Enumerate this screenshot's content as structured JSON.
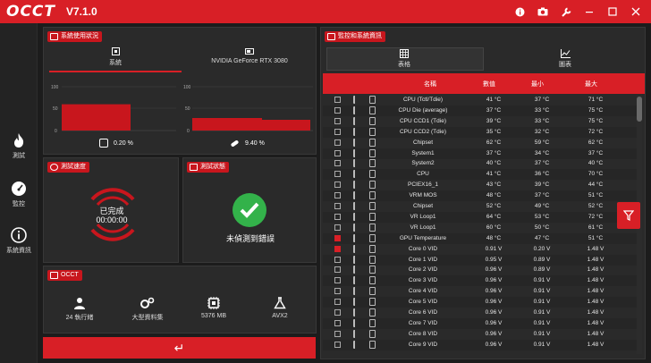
{
  "app": {
    "logo": "OCCT",
    "version": "V7.1.0"
  },
  "titlebar_icons": [
    "info-icon",
    "camera-icon",
    "wrench-icon",
    "minimize-icon",
    "maximize-icon",
    "close-icon"
  ],
  "rail": [
    {
      "label": "測試",
      "icon": "flame-icon"
    },
    {
      "label": "監控",
      "icon": "gauge-icon"
    },
    {
      "label": "系統資訊",
      "icon": "info-icon"
    }
  ],
  "usage": {
    "title": "系統使用狀況",
    "tabs": [
      "系統",
      "NVIDIA GeForce RTX 3080"
    ],
    "cpu_value": "0.20 %",
    "gpu_value": "9.40 %",
    "cpu_chart": {
      "ticks": [
        "100",
        "50",
        "0"
      ],
      "level": 0.6
    },
    "gpu_chart": {
      "ticks": [
        "100",
        "50",
        "0"
      ],
      "level": 0.12
    }
  },
  "speed": {
    "title": "測試速度",
    "status": "已完成",
    "time": "00:00:00"
  },
  "state": {
    "title": "測試狀態",
    "message": "未偵測到錯誤"
  },
  "occt": {
    "title": "OCCT",
    "stats": [
      {
        "label": "24 執行緒",
        "icon": "worker-icon"
      },
      {
        "label": "大型資料集",
        "icon": "gears-icon"
      },
      {
        "label": "5376 MB",
        "icon": "chip-icon"
      },
      {
        "label": "AVX2",
        "icon": "flask-icon"
      }
    ]
  },
  "run_button": "↵",
  "monitor": {
    "title": "監控和系統資訊",
    "tabs": [
      "表格",
      "圖表"
    ],
    "columns": [
      "名稱",
      "數值",
      "最小",
      "最大"
    ],
    "rows": [
      {
        "name": "CPU (Tctl/Tdie)",
        "value": "41 °C",
        "min": "37 °C",
        "max": "71 °C",
        "checked": false
      },
      {
        "name": "CPU Die (average)",
        "value": "37 °C",
        "min": "33 °C",
        "max": "75 °C",
        "checked": false
      },
      {
        "name": "CPU CCD1 (Tdie)",
        "value": "39 °C",
        "min": "33 °C",
        "max": "75 °C",
        "checked": false
      },
      {
        "name": "CPU CCD2 (Tdie)",
        "value": "35 °C",
        "min": "32 °C",
        "max": "72 °C",
        "checked": false
      },
      {
        "name": "Chipset",
        "value": "62 °C",
        "min": "59 °C",
        "max": "62 °C",
        "checked": false
      },
      {
        "name": "System1",
        "value": "37 °C",
        "min": "34 °C",
        "max": "37 °C",
        "checked": false
      },
      {
        "name": "System2",
        "value": "40 °C",
        "min": "37 °C",
        "max": "40 °C",
        "checked": false
      },
      {
        "name": "CPU",
        "value": "41 °C",
        "min": "36 °C",
        "max": "70 °C",
        "checked": false
      },
      {
        "name": "PCIEX16_1",
        "value": "43 °C",
        "min": "39 °C",
        "max": "44 °C",
        "checked": false
      },
      {
        "name": "VRM MOS",
        "value": "48 °C",
        "min": "37 °C",
        "max": "51 °C",
        "checked": false
      },
      {
        "name": "Chipset",
        "value": "52 °C",
        "min": "49 °C",
        "max": "52 °C",
        "checked": false
      },
      {
        "name": "VR Loop1",
        "value": "64 °C",
        "min": "53 °C",
        "max": "72 °C",
        "checked": false
      },
      {
        "name": "VR Loop1",
        "value": "60 °C",
        "min": "50 °C",
        "max": "61 °C",
        "checked": false
      },
      {
        "name": "GPU Temperature",
        "value": "48 °C",
        "min": "47 °C",
        "max": "51 °C",
        "checked": true
      },
      {
        "name": "Core 0 VID",
        "value": "0.91 V",
        "min": "0.20 V",
        "max": "1.48 V",
        "checked": true
      },
      {
        "name": "Core 1 VID",
        "value": "0.95 V",
        "min": "0.89 V",
        "max": "1.48 V",
        "checked": false
      },
      {
        "name": "Core 2 VID",
        "value": "0.96 V",
        "min": "0.89 V",
        "max": "1.48 V",
        "checked": false
      },
      {
        "name": "Core 3 VID",
        "value": "0.96 V",
        "min": "0.91 V",
        "max": "1.48 V",
        "checked": false
      },
      {
        "name": "Core 4 VID",
        "value": "0.96 V",
        "min": "0.91 V",
        "max": "1.48 V",
        "checked": false
      },
      {
        "name": "Core 5 VID",
        "value": "0.96 V",
        "min": "0.91 V",
        "max": "1.48 V",
        "checked": false
      },
      {
        "name": "Core 6 VID",
        "value": "0.96 V",
        "min": "0.91 V",
        "max": "1.48 V",
        "checked": false
      },
      {
        "name": "Core 7 VID",
        "value": "0.96 V",
        "min": "0.91 V",
        "max": "1.48 V",
        "checked": false
      },
      {
        "name": "Core 8 VID",
        "value": "0.96 V",
        "min": "0.91 V",
        "max": "1.48 V",
        "checked": false
      },
      {
        "name": "Core 9 VID",
        "value": "0.96 V",
        "min": "0.91 V",
        "max": "1.48 V",
        "checked": false
      }
    ]
  },
  "colors": {
    "accent": "#d81f26",
    "success": "#33b24a",
    "panel": "#2a2a2a"
  }
}
